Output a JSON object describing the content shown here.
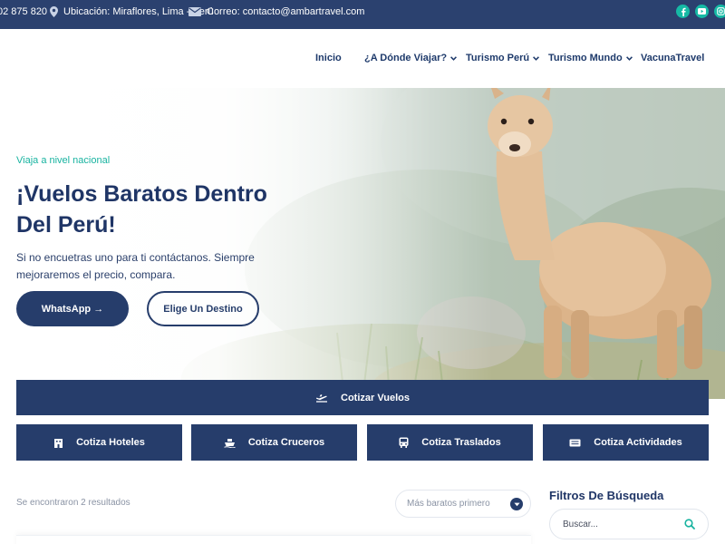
{
  "topbar": {
    "phone": "02 875 820",
    "location": "Ubicación: Miraflores, Lima - Perú",
    "email": "Correo: contacto@ambartravel.com",
    "social_icons": [
      "facebook-icon",
      "youtube-icon",
      "instagram-icon"
    ],
    "accent": "#16b9a5",
    "background": "#2b416f"
  },
  "nav": {
    "items": [
      {
        "label": "Inicio",
        "dropdown": false
      },
      {
        "label": "¿A Dónde Viajar?",
        "dropdown": true
      },
      {
        "label": "Turismo Perú",
        "dropdown": true
      },
      {
        "label": "Turismo Mundo",
        "dropdown": true
      },
      {
        "label": "VacunaTravel",
        "dropdown": false
      }
    ]
  },
  "hero": {
    "eyebrow": "Viaja a nivel nacional",
    "title": "¡Vuelos Baratos Dentro Del Perú!",
    "subtitle": "Si no encuetras uno para ti contáctanos. Siempre mejoraremos el precio, compara.",
    "primary_button": "WhatsApp →",
    "secondary_button": "Elige Un Destino",
    "image": "alpaca-photo"
  },
  "quote": {
    "main": {
      "label": "Cotizar Vuelos",
      "icon": "plane-icon"
    },
    "buttons": [
      {
        "label": "Cotiza Hoteles",
        "icon": "hotel-icon"
      },
      {
        "label": "Cotiza Cruceros",
        "icon": "ship-icon"
      },
      {
        "label": "Cotiza Traslados",
        "icon": "bus-icon"
      },
      {
        "label": "Cotiza Actividades",
        "icon": "ticket-icon"
      }
    ]
  },
  "results": {
    "count_text": "Se encontraron 2 resultados",
    "sort_selected": "Más baratos primero"
  },
  "filters": {
    "title": "Filtros De Búsqueda",
    "search_placeholder": "Buscar..."
  },
  "colors": {
    "primary": "#263d6b",
    "accent": "#18b3a0",
    "heading": "#1f3566"
  }
}
